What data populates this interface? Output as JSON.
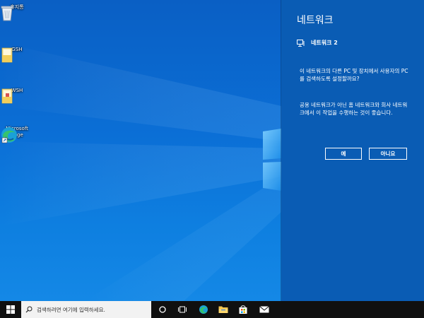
{
  "desktop": {
    "icons": [
      {
        "label": "휴지통",
        "icon": "recycle-bin-icon"
      },
      {
        "label": "GSH",
        "icon": "folder-icon"
      },
      {
        "label": "WSH",
        "icon": "folder-icon"
      },
      {
        "label": "Microsoft Edge",
        "icon": "edge-icon"
      }
    ]
  },
  "network_flyout": {
    "title": "네트워크",
    "network_name": "네트워크 2",
    "question": "이 네트워크의 다른 PC 및 장치에서 사용자의 PC를 검색하도록 설정할까요?",
    "description": "공용 네트워크가 아닌 홈 네트워크와 회사 네트워크에서 이 작업을 수행하는 것이 좋습니다.",
    "yes_label": "예",
    "no_label": "아니요"
  },
  "taskbar": {
    "search_placeholder": "검색하려면 여기에 입력하세요.",
    "items": [
      "cortana-icon",
      "task-view-icon",
      "edge-icon",
      "file-explorer-icon",
      "store-icon",
      "mail-icon"
    ]
  },
  "colors": {
    "panel_bg": "#0a5cb4",
    "taskbar_bg": "#101010",
    "wallpaper": "#0b6fd6"
  }
}
